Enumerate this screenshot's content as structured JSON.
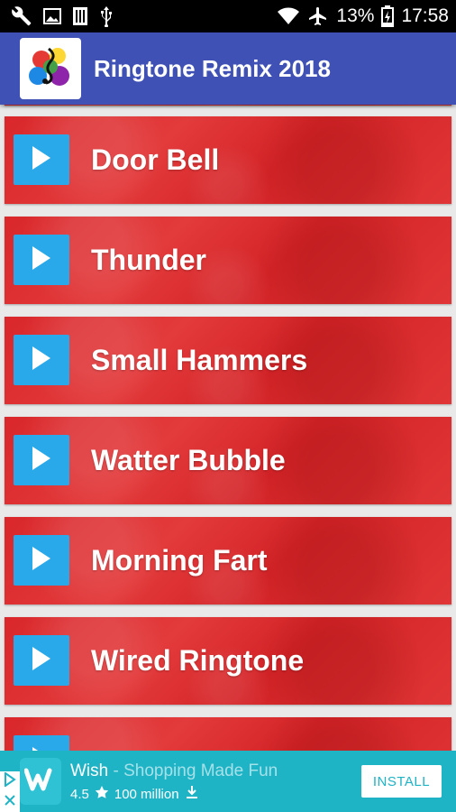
{
  "status_bar": {
    "battery": "13%",
    "time": "17:58",
    "icons": [
      "wrench-icon",
      "image-icon",
      "sim-icon",
      "usb-icon",
      "wifi-icon",
      "airplane-icon",
      "battery-icon"
    ]
  },
  "app_bar": {
    "title": "Ringtone Remix 2018",
    "logo": "music-note-logo"
  },
  "ringtones": [
    {
      "label": "Door Bell"
    },
    {
      "label": "Thunder"
    },
    {
      "label": "Small Hammers"
    },
    {
      "label": "Watter Bubble"
    },
    {
      "label": "Morning Fart"
    },
    {
      "label": "Wired Ringtone"
    },
    {
      "label": ""
    }
  ],
  "colors": {
    "app_bar": "#3f51b5",
    "item_red": "#dc2e30",
    "play_blue": "#29a8ea",
    "ad_teal": "#1fb3c6"
  },
  "ad": {
    "app_name": "Wish",
    "tagline": " - Shopping Made Fun",
    "rating": "4.5",
    "downloads": "100 million",
    "install_label": "INSTALL"
  }
}
